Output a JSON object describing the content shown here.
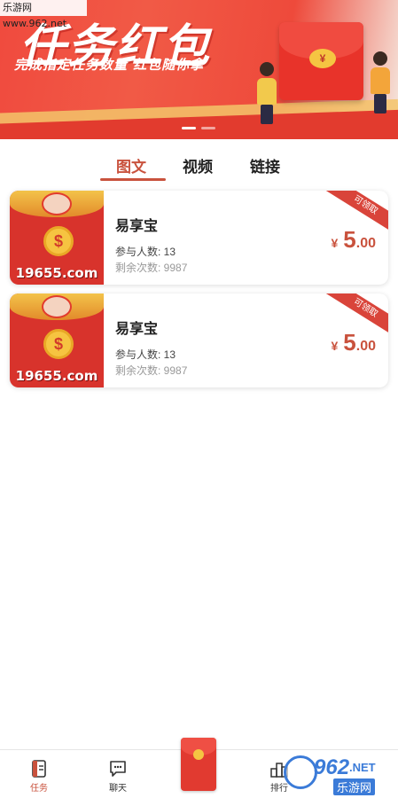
{
  "watermark": {
    "text": "乐游网 www.962.net"
  },
  "banner": {
    "title": "任务红包",
    "subtitle": "完成指定任务数量  红包随你拿",
    "envelope_symbol": "¥",
    "slide_count": 2,
    "active_slide": 1
  },
  "tabs": [
    {
      "label": "图文",
      "active": true
    },
    {
      "label": "视频",
      "active": false
    },
    {
      "label": "链接",
      "active": false
    }
  ],
  "tasks": [
    {
      "thumb_text": "19655.com",
      "thumb_coin": "$",
      "name": "易享宝",
      "people": "参与人数: 13",
      "remaining": "剩余次数: 9987",
      "currency": "¥",
      "price_int": "5",
      "price_dec": ".00",
      "ribbon": "可领取"
    },
    {
      "thumb_text": "19655.com",
      "thumb_coin": "$",
      "name": "易享宝",
      "people": "参与人数: 13",
      "remaining": "剩余次数: 9987",
      "currency": "¥",
      "price_int": "5",
      "price_dec": ".00",
      "ribbon": "可领取"
    }
  ],
  "bottom_nav": [
    {
      "label": "任务",
      "icon": "task-list-icon",
      "active": true
    },
    {
      "label": "聊天",
      "icon": "chat-icon",
      "active": false
    },
    {
      "label": "",
      "icon": "red-envelope-icon",
      "active": false
    },
    {
      "label": "排行",
      "icon": "ranking-icon",
      "active": false
    }
  ],
  "site_logo": {
    "number": "962",
    "suffix": ".NET",
    "cn": "乐游网"
  },
  "colors": {
    "accent": "#c9523d",
    "banner_red": "#f04a3e",
    "envelope": "#e13a30"
  }
}
